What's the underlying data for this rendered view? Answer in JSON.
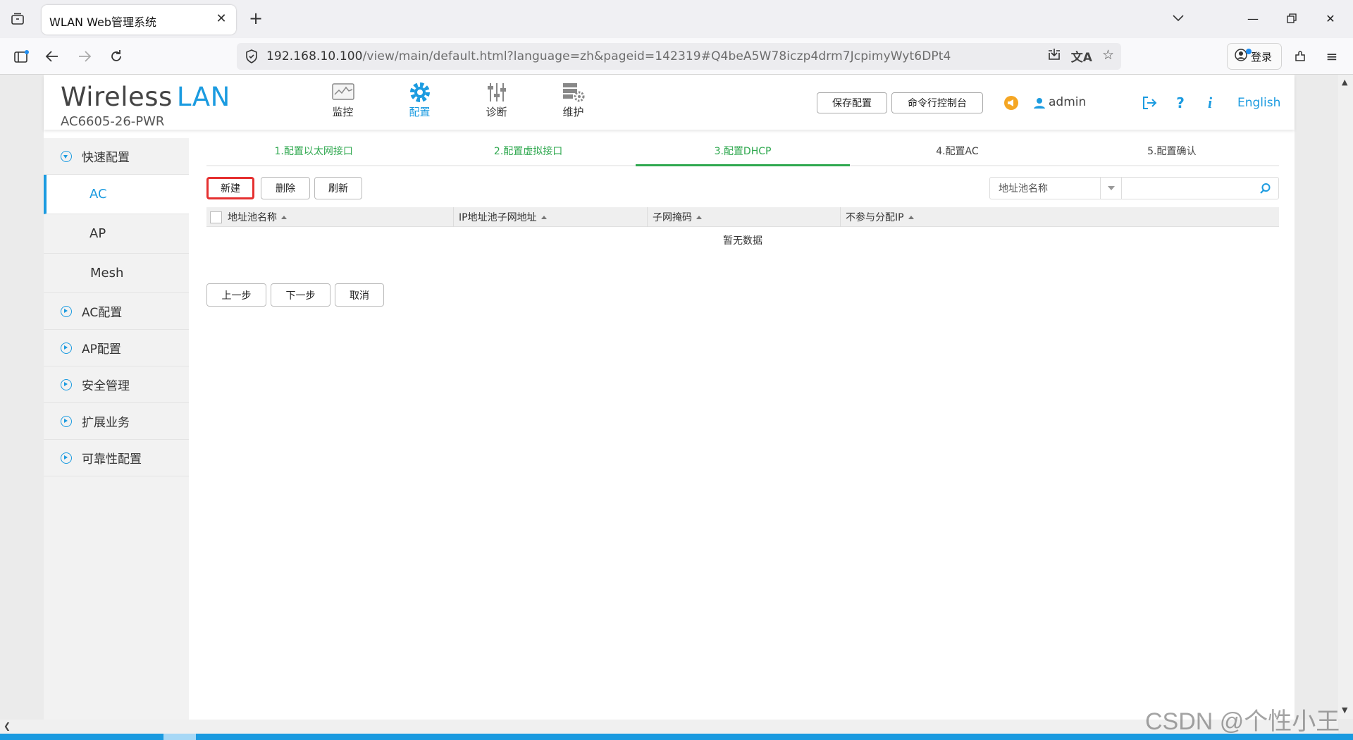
{
  "browser": {
    "tab_title": "WLAN Web管理系统",
    "url_host": "192.168.10.100",
    "url_path": "/view/main/default.html?language=zh&pageid=142319#Q4beA5W78iczp4drm7JcpimyWyt6DPt4",
    "login_label": "登录"
  },
  "header": {
    "brand_main": "Wireless",
    "brand_accent": "LAN",
    "model": "AC6605-26-PWR",
    "nav": [
      {
        "label": "监控",
        "icon": "monitor-icon"
      },
      {
        "label": "配置",
        "icon": "gear-icon"
      },
      {
        "label": "诊断",
        "icon": "sliders-icon"
      },
      {
        "label": "维护",
        "icon": "maintenance-icon"
      }
    ],
    "save_config": "保存配置",
    "cli_console": "命令行控制台",
    "username": "admin",
    "language": "English"
  },
  "sidebar": {
    "quick_config": "快速配置",
    "sub_items": [
      "AC",
      "AP",
      "Mesh"
    ],
    "items": [
      "AC配置",
      "AP配置",
      "安全管理",
      "扩展业务",
      "可靠性配置"
    ]
  },
  "wizard": {
    "steps": [
      "1.配置以太网接口",
      "2.配置虚拟接口",
      "3.配置DHCP",
      "4.配置AC",
      "5.配置确认"
    ],
    "current_step": 3
  },
  "actions": {
    "new": "新建",
    "delete": "删除",
    "refresh": "刷新",
    "filter_field": "地址池名称",
    "filter_value": ""
  },
  "table": {
    "columns": [
      "地址池名称",
      "IP地址池子网地址",
      "子网掩码",
      "不参与分配IP"
    ],
    "rows": [],
    "empty_text": "暂无数据"
  },
  "pager": {
    "prev": "上一步",
    "next": "下一步",
    "cancel": "取消"
  },
  "watermark": "CSDN @个性小王",
  "colors": {
    "accent": "#1b9be0",
    "step_done": "#2fa84f",
    "highlight_box": "#e53030"
  }
}
